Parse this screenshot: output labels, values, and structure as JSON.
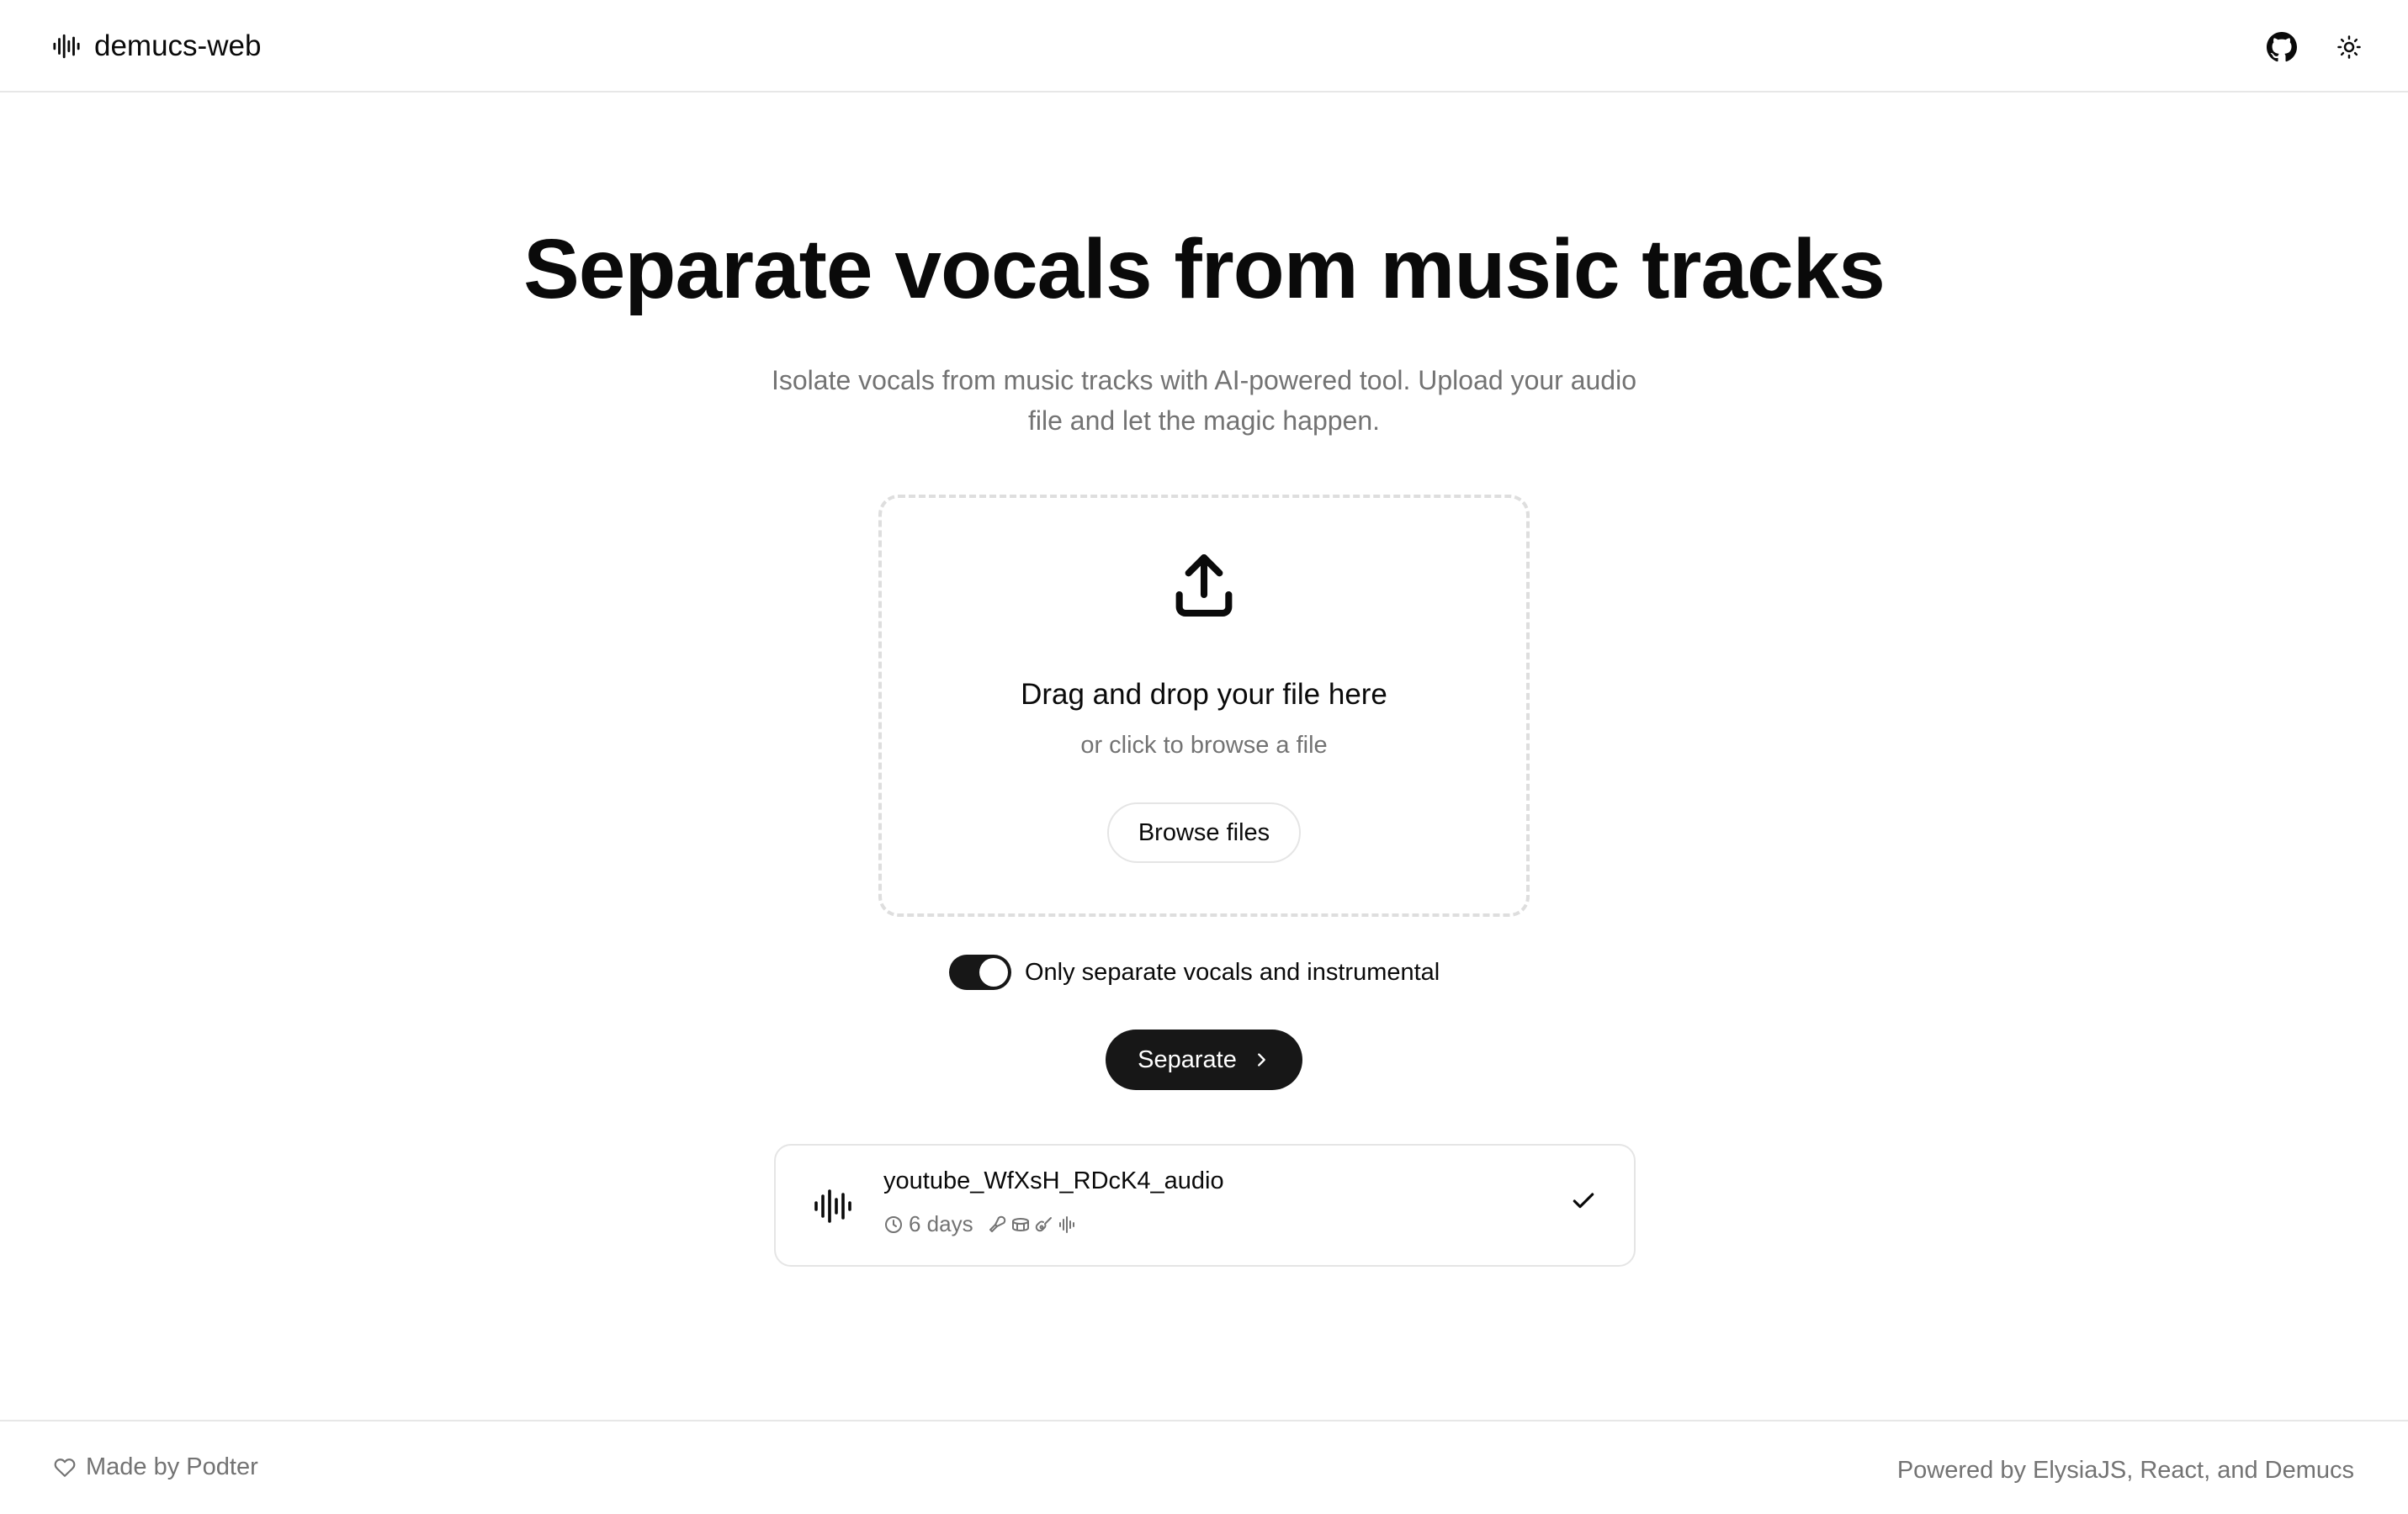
{
  "app": {
    "name": "demucs-web",
    "logo_icon": "audio-waveform-icon"
  },
  "header": {
    "actions": [
      {
        "icon": "github-icon"
      },
      {
        "icon": "sun-icon"
      }
    ]
  },
  "hero": {
    "title": "Separate vocals from music tracks",
    "subtitle": "Isolate vocals from music tracks with AI-powered tool. Upload your audio file and let the magic happen."
  },
  "dropzone": {
    "icon": "upload-icon",
    "title": "Drag and drop your file here",
    "subtitle": "or click to browse a file",
    "browse_label": "Browse files"
  },
  "options": {
    "vocals_only_label": "Only separate vocals and instrumental",
    "vocals_only_enabled": true
  },
  "actions": {
    "separate_label": "Separate"
  },
  "jobs": [
    {
      "name": "youtube_WfXsH_RDcK4_audio",
      "age": "6 days",
      "stems": [
        "microphone-icon",
        "drum-icon",
        "guitar-icon",
        "audio-waveform-icon"
      ],
      "status": "completed"
    }
  ],
  "footer": {
    "made_by": "Made by Podter",
    "powered_by": "Powered by ElysiaJS, React, and Demucs"
  },
  "colors": {
    "text": "#0a0a0a",
    "muted": "#737373",
    "border": "#e5e5e5",
    "primary": "#171717",
    "background": "#ffffff"
  }
}
